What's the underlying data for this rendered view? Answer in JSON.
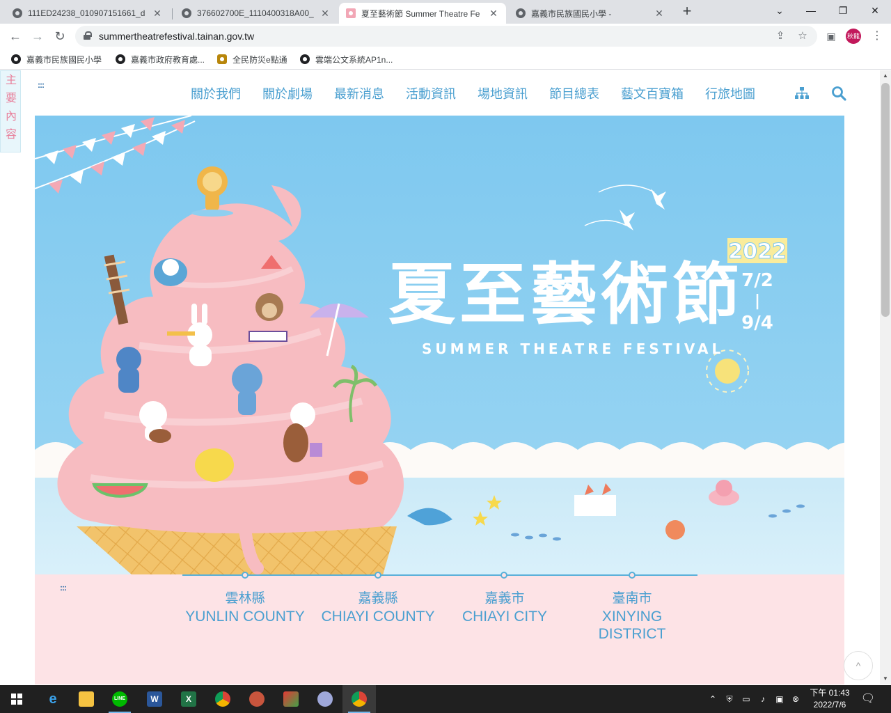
{
  "browser": {
    "tabs": [
      {
        "title": "111ED24238_010907151661_d",
        "active": false
      },
      {
        "title": "376602700E_1110400318A00_",
        "active": false
      },
      {
        "title": "夏至藝術節 Summer Theatre Fe",
        "active": true
      },
      {
        "title": "嘉義市民族國民小學 -",
        "active": false
      }
    ],
    "new_tab": "+",
    "url": "summertheatrefestival.tainan.gov.tw",
    "profile_label": "秋龍",
    "bookmarks": [
      "嘉義市民族國民小學",
      "嘉義市政府教育處...",
      "全民防災e點通",
      "雲端公文系統AP1n..."
    ]
  },
  "site": {
    "side_tab": [
      "主",
      "要",
      "內",
      "容"
    ],
    "accessibility_marker": ":::",
    "nav": [
      "關於我們",
      "關於劇場",
      "最新消息",
      "活動資訊",
      "場地資訊",
      "節目總表",
      "藝文百寶箱",
      "行旅地圖"
    ],
    "nav_icons": [
      "sitemap-icon",
      "search-icon"
    ],
    "hero": {
      "title_zh": "夏至藝術節",
      "title_en": "SUMMER THEATRE FESTIVAL",
      "year": "2022",
      "dates": [
        "7/2",
        "|",
        "9/4"
      ]
    },
    "venues": [
      {
        "zh": "雲林縣",
        "en": [
          "YUNLIN COUNTY"
        ]
      },
      {
        "zh": "嘉義縣",
        "en": [
          "CHIAYI COUNTY"
        ]
      },
      {
        "zh": "嘉義市",
        "en": [
          "CHIAYI CITY"
        ]
      },
      {
        "zh": "臺南市",
        "en": [
          "XINYING",
          "DISTRICT"
        ]
      }
    ],
    "to_top": "^"
  },
  "taskbar": {
    "apps": [
      "Internet Explorer",
      "File Explorer",
      "LINE",
      "Word",
      "Excel",
      "Chrome",
      "App",
      "App",
      "App",
      "Chrome"
    ],
    "time": "下午 01:43",
    "date": "2022/7/6"
  },
  "colors": {
    "nav_text": "#4a9fd0",
    "hero_sky": "#8fcff0",
    "venue_bg": "#fde3e6",
    "side_tab_text": "#e87f9a"
  }
}
